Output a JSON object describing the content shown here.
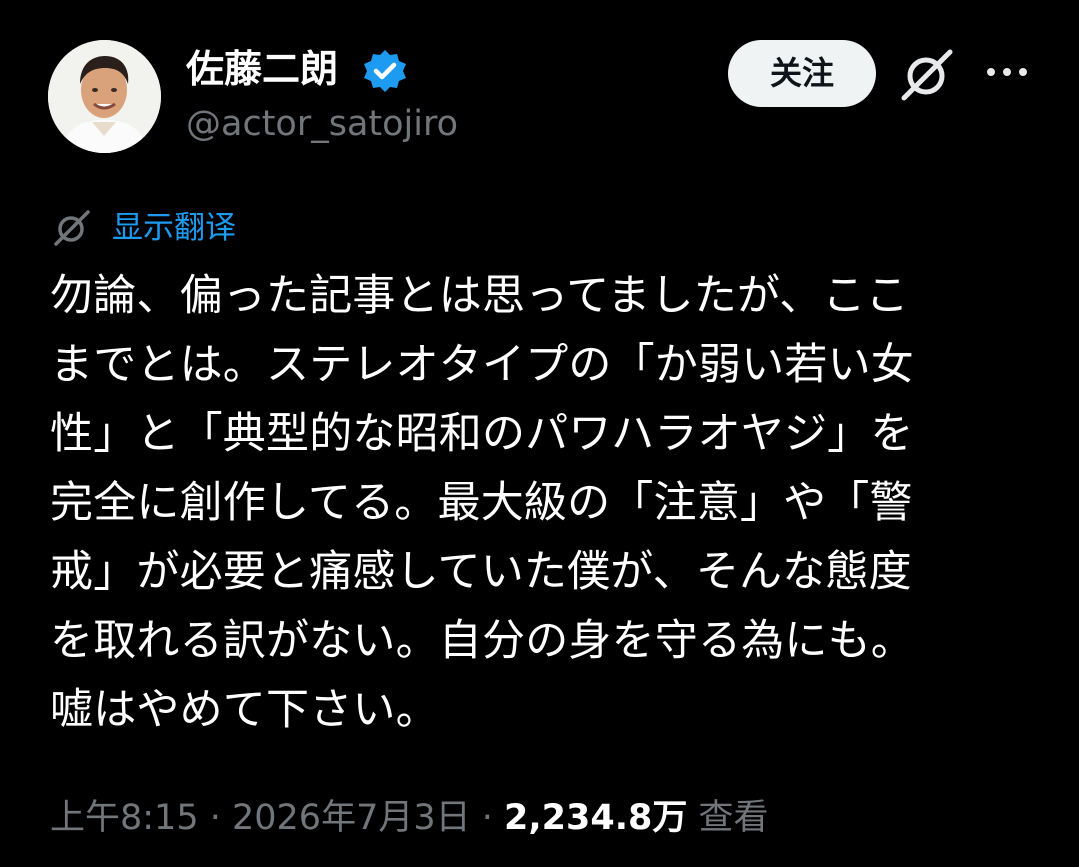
{
  "author": {
    "display_name": "佐藤二朗",
    "handle": "@actor_satojiro",
    "verified": true,
    "verified_color": "#1d9bf0",
    "avatar_icon": "profile-photo"
  },
  "actions": {
    "follow_label": "关注",
    "grok_icon": "grok-icon",
    "more_icon": "more-dots-icon"
  },
  "translate": {
    "label": "显示翻译",
    "icon": "grok-icon",
    "color": "#1d9bf0"
  },
  "tweet": {
    "lines": [
      "勿論、偏った記事とは思ってましたが、ここ",
      "までとは。ステレオタイプの「か弱い若い女",
      "性」と「典型的な昭和のパワハラオヤジ」を",
      "完全に創作してる。最大級の「注意」や「警",
      "戒」が必要と痛感していた僕が、そんな態度",
      "を取れる訳がない。自分の身を守る為にも。",
      "嘘はやめて下さい。"
    ]
  },
  "meta": {
    "time": "上午8:15",
    "separator": " · ",
    "date": "2026年7月3日",
    "views_count": "2,234.8万",
    "views_label": "查看"
  }
}
